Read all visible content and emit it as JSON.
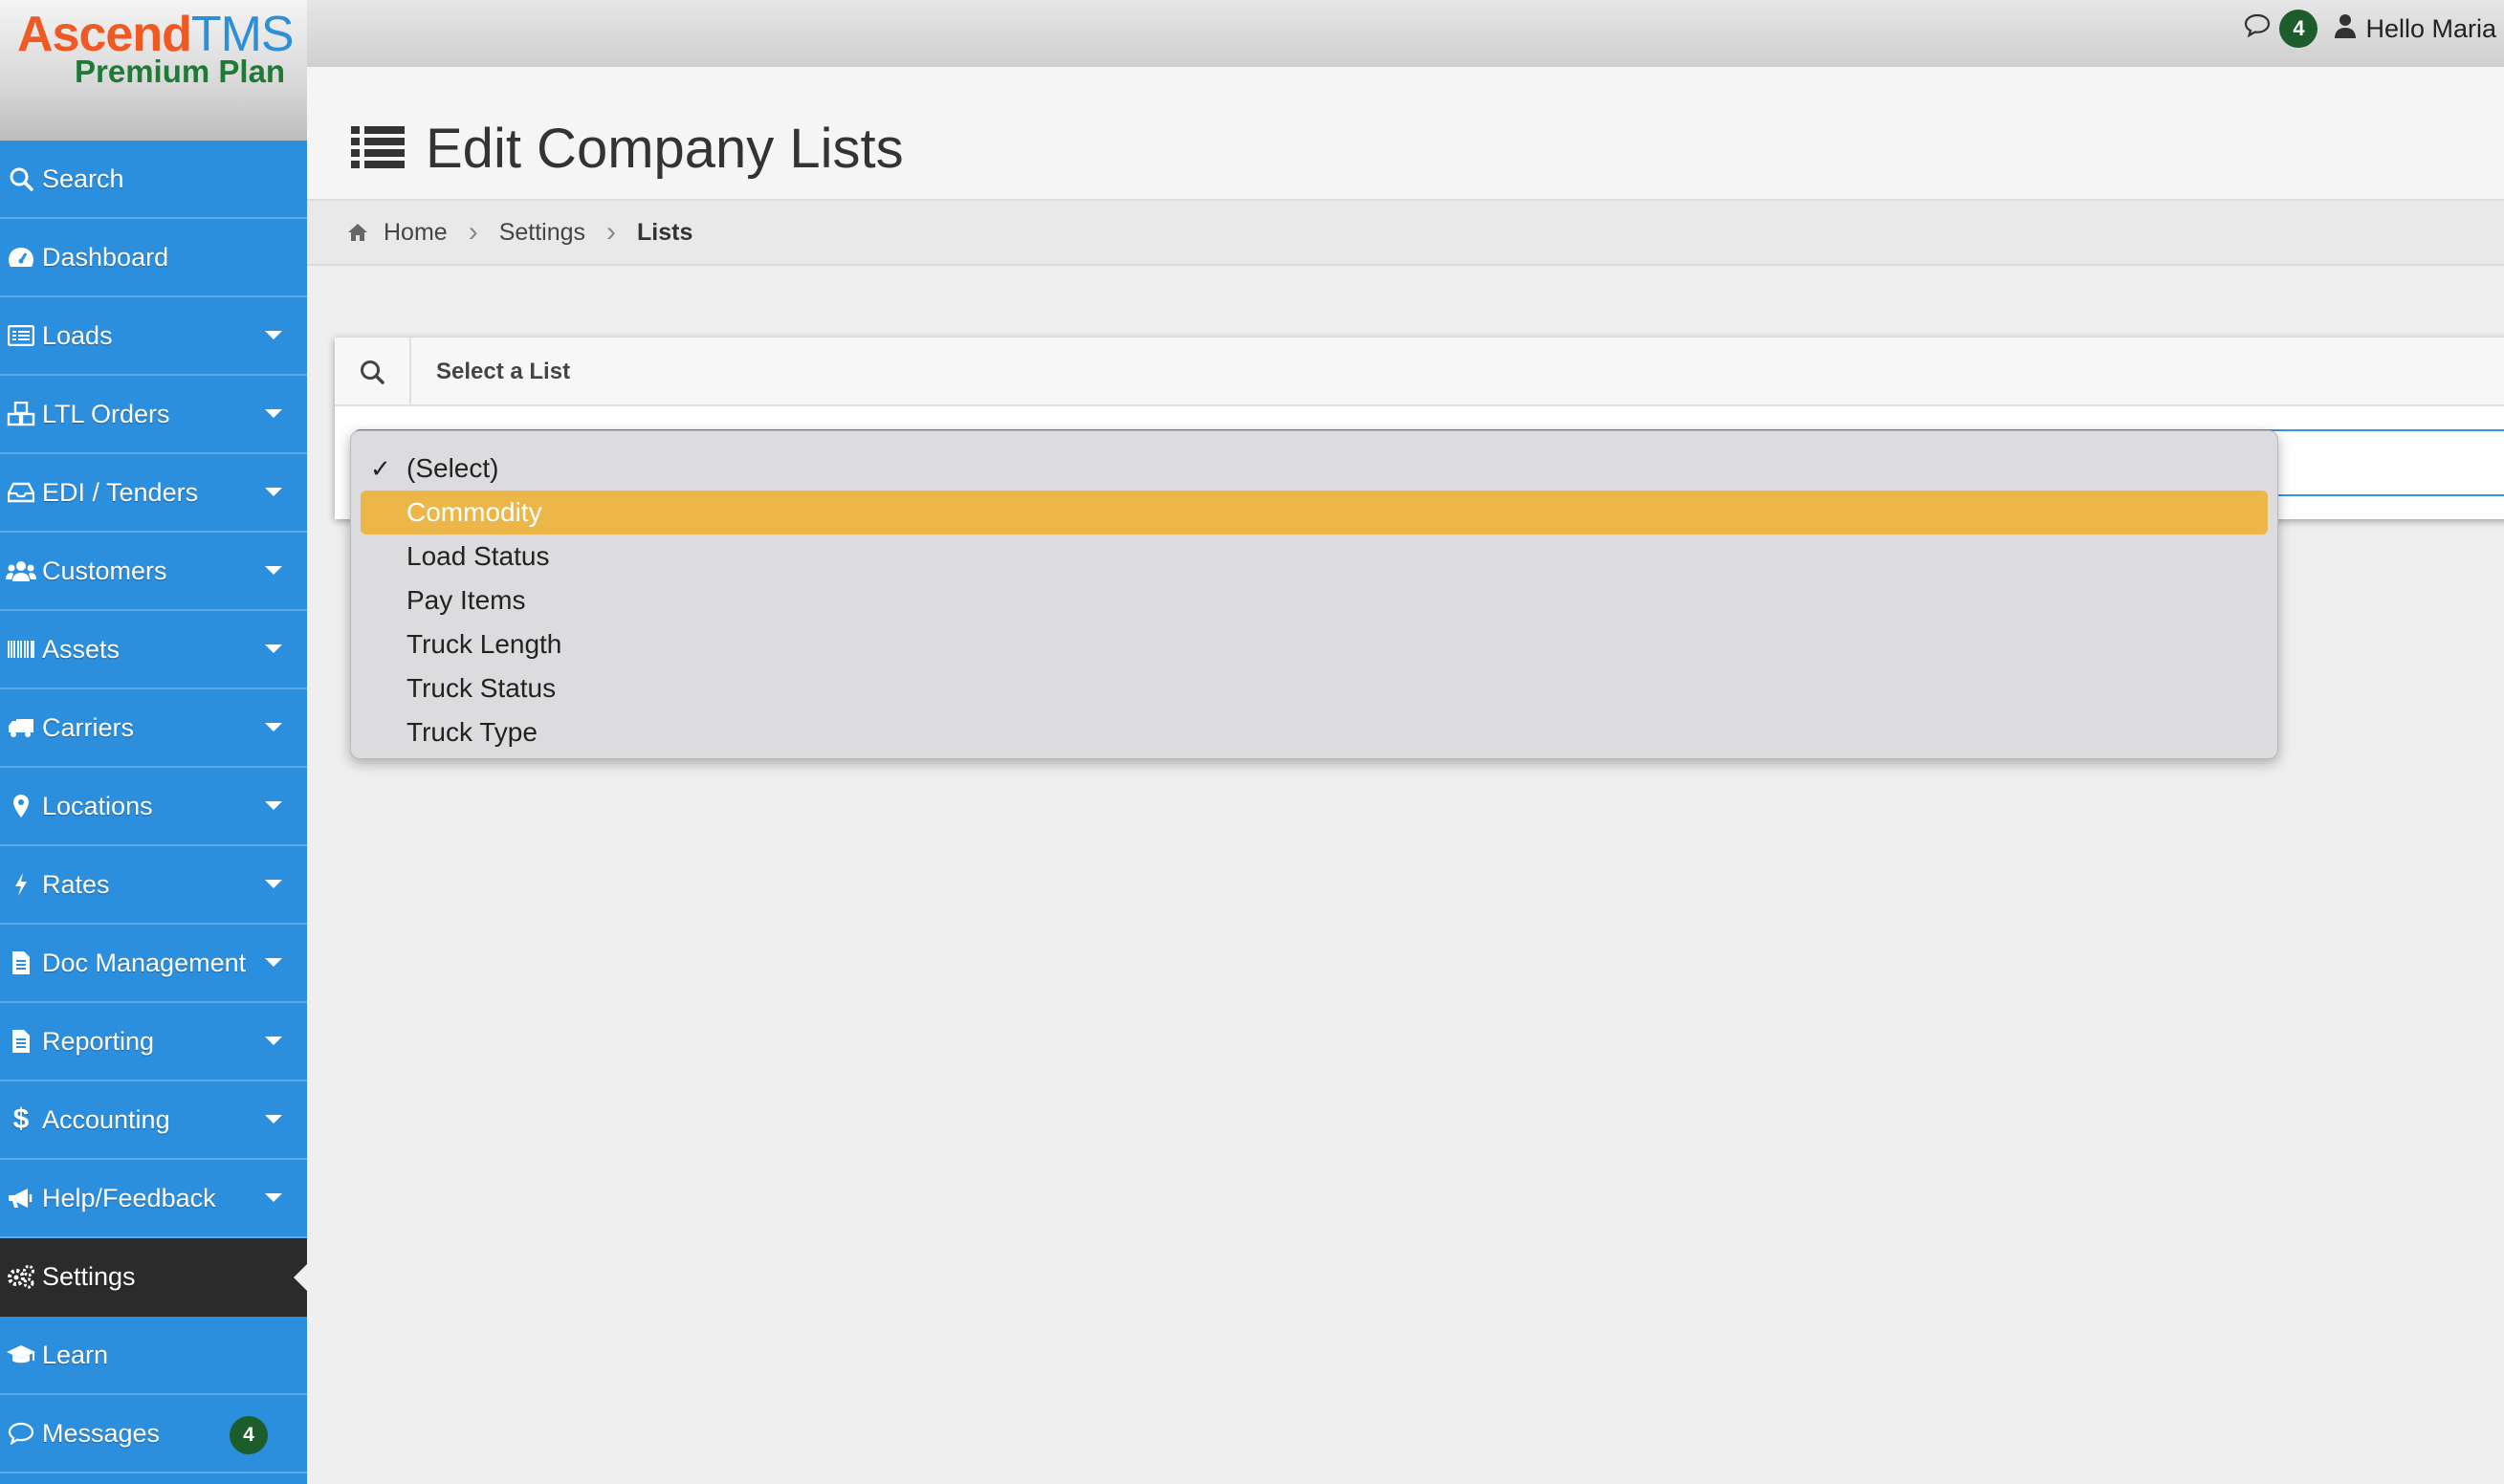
{
  "app": {
    "brand_part1": "Ascend",
    "brand_part2": "TMS",
    "plan": "Premium Plan"
  },
  "header": {
    "messages_count": "4",
    "greeting": "Hello Maria"
  },
  "sidebar": {
    "items": [
      {
        "label": "Search",
        "icon": "search-icon",
        "has_caret": false
      },
      {
        "label": "Dashboard",
        "icon": "dashboard-icon",
        "has_caret": false
      },
      {
        "label": "Loads",
        "icon": "list-icon",
        "has_caret": true
      },
      {
        "label": "LTL Orders",
        "icon": "boxes-icon",
        "has_caret": true
      },
      {
        "label": "EDI / Tenders",
        "icon": "inbox-icon",
        "has_caret": true
      },
      {
        "label": "Customers",
        "icon": "users-icon",
        "has_caret": true
      },
      {
        "label": "Assets",
        "icon": "barcode-icon",
        "has_caret": true
      },
      {
        "label": "Carriers",
        "icon": "truck-icon",
        "has_caret": true
      },
      {
        "label": "Locations",
        "icon": "map-marker-icon",
        "has_caret": true
      },
      {
        "label": "Rates",
        "icon": "bolt-icon",
        "has_caret": true
      },
      {
        "label": "Doc Management",
        "icon": "document-icon",
        "has_caret": true
      },
      {
        "label": "Reporting",
        "icon": "report-icon",
        "has_caret": true
      },
      {
        "label": "Accounting",
        "icon": "dollar-icon",
        "has_caret": true
      },
      {
        "label": "Help/Feedback",
        "icon": "megaphone-icon",
        "has_caret": true
      },
      {
        "label": "Settings",
        "icon": "gears-icon",
        "has_caret": false,
        "active": true
      },
      {
        "label": "Learn",
        "icon": "graduation-cap-icon",
        "has_caret": false
      },
      {
        "label": "Messages",
        "icon": "comment-icon",
        "has_caret": false,
        "badge": "4"
      }
    ]
  },
  "page": {
    "title": "Edit Company Lists"
  },
  "breadcrumb": {
    "home": "Home",
    "settings": "Settings",
    "current": "Lists"
  },
  "panel": {
    "title": "Select a List"
  },
  "dropdown": {
    "selected": "(Select)",
    "highlighted": "Commodity",
    "options": [
      "(Select)",
      "Commodity",
      "Load Status",
      "Pay Items",
      "Truck Length",
      "Truck Status",
      "Truck Type"
    ]
  },
  "colors": {
    "sidebar_bg": "#2c8fde",
    "sidebar_active_bg": "#2b2b2b",
    "badge_green": "#1d5c2b",
    "highlight": "#ecb748",
    "brand_orange": "#ef5a24",
    "brand_blue": "#2d8fd6",
    "plan_green": "#1f7a35"
  }
}
